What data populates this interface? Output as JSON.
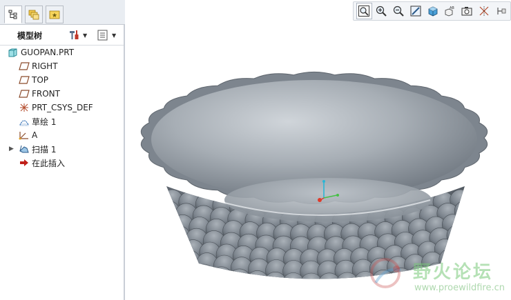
{
  "model_tree": {
    "title": "模型树",
    "items": [
      {
        "label": "GUOPAN.PRT",
        "icon": "part-icon"
      },
      {
        "label": "RIGHT",
        "icon": "datum-plane-icon"
      },
      {
        "label": "TOP",
        "icon": "datum-plane-icon"
      },
      {
        "label": "FRONT",
        "icon": "datum-plane-icon"
      },
      {
        "label": "PRT_CSYS_DEF",
        "icon": "coordinate-system-icon"
      },
      {
        "label": "草绘 1",
        "icon": "sketch-icon"
      },
      {
        "label": "A",
        "icon": "datum-axis-icon"
      },
      {
        "label": "扫描 1",
        "icon": "sweep-feature-icon"
      },
      {
        "label": "在此插入",
        "icon": "insert-here-arrow-icon"
      }
    ]
  },
  "watermark": {
    "text": "野火论坛",
    "url": "www.proewildfire.cn"
  },
  "colors": {
    "model": "#8a929b",
    "toolbar_bg": "#f3f5f8",
    "panel_border": "#c9ced6"
  }
}
